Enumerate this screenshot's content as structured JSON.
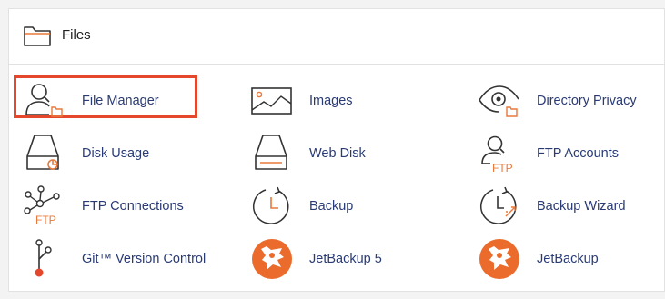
{
  "section": {
    "title": "Files",
    "icon": "folder-icon"
  },
  "accent_color": "#e4472b",
  "link_color": "#293a75",
  "icon_accent": "#e8793a",
  "items": [
    {
      "label": "File Manager",
      "icon": "file-manager-icon"
    },
    {
      "label": "Images",
      "icon": "images-icon"
    },
    {
      "label": "Directory Privacy",
      "icon": "directory-privacy-icon"
    },
    {
      "label": "Disk Usage",
      "icon": "disk-usage-icon"
    },
    {
      "label": "Web Disk",
      "icon": "web-disk-icon"
    },
    {
      "label": "FTP Accounts",
      "icon": "ftp-accounts-icon"
    },
    {
      "label": "FTP Connections",
      "icon": "ftp-connections-icon"
    },
    {
      "label": "Backup",
      "icon": "backup-icon"
    },
    {
      "label": "Backup Wizard",
      "icon": "backup-wizard-icon"
    },
    {
      "label": "Git™ Version Control",
      "icon": "git-version-control-icon"
    },
    {
      "label": "JetBackup 5",
      "icon": "jetbackup-5-icon"
    },
    {
      "label": "JetBackup",
      "icon": "jetbackup-icon"
    }
  ],
  "ftp_text": "FTP"
}
